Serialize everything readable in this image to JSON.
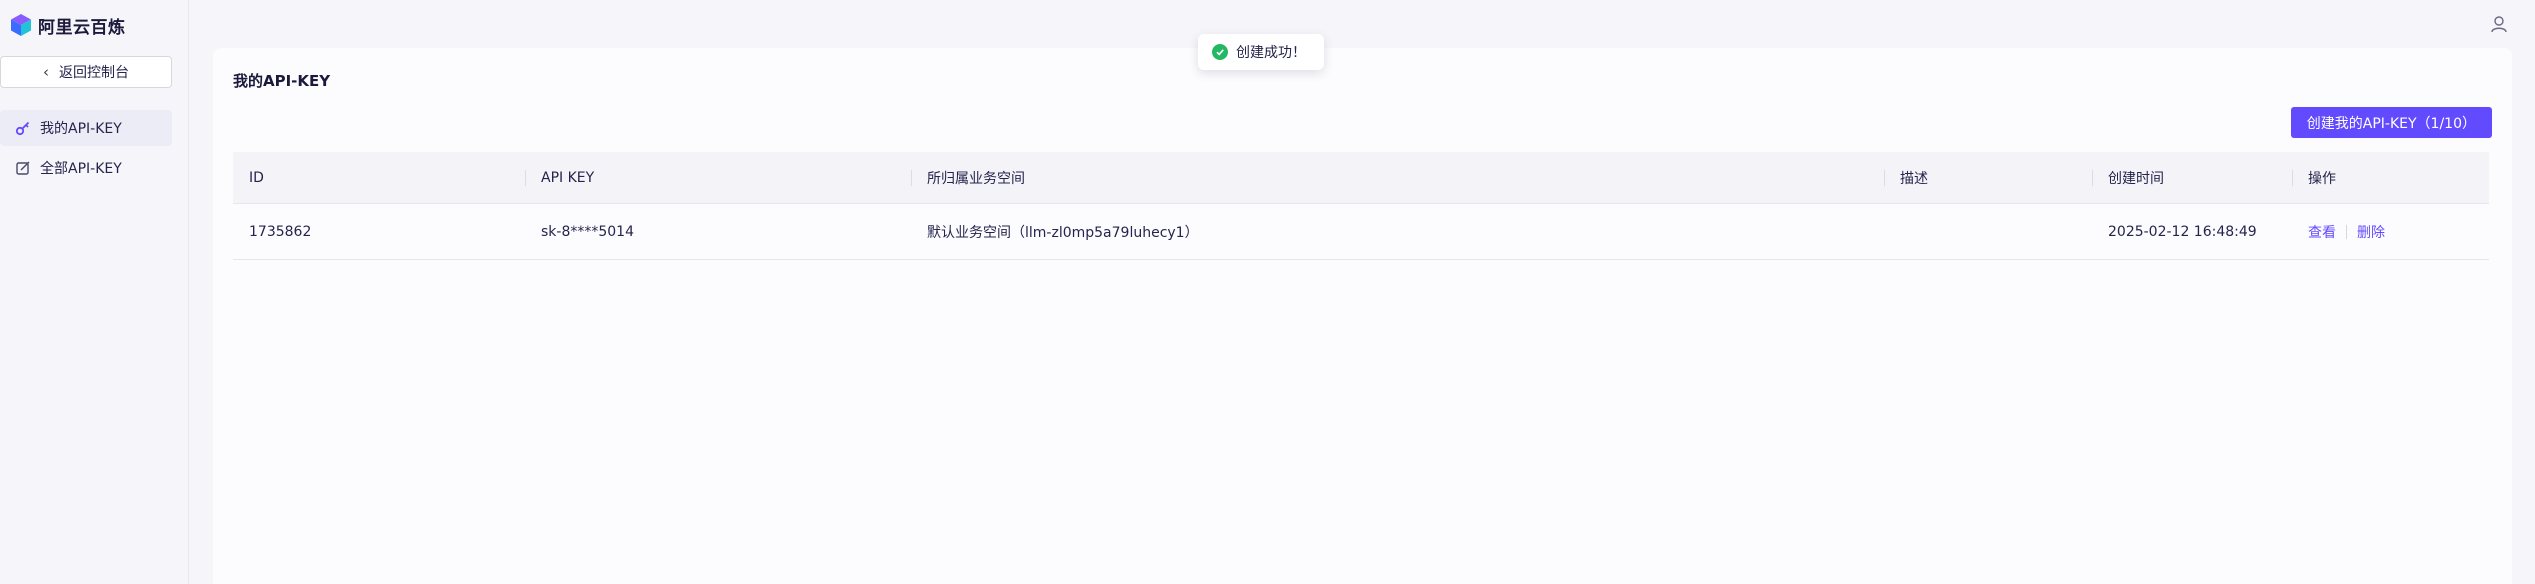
{
  "brand": {
    "name": "阿里云百炼"
  },
  "sidebar": {
    "back_label": "返回控制台",
    "items": [
      {
        "label": "我的API-KEY",
        "icon": "key-icon",
        "active": true
      },
      {
        "label": "全部API-KEY",
        "icon": "edit-box-icon",
        "active": false
      }
    ]
  },
  "toast": {
    "message": "创建成功！",
    "icon": "check-circle-icon",
    "color": "#25b864"
  },
  "main": {
    "title": "我的API-KEY",
    "create_button": "创建我的API-KEY（1/10）",
    "accent": "#624aff",
    "table": {
      "columns": [
        "ID",
        "API KEY",
        "所归属业务空间",
        "描述",
        "创建时间",
        "操作"
      ],
      "rows": [
        {
          "id": "1735862",
          "api_key": "sk-8****5014",
          "workspace": "默认业务空间（llm-zl0mp5a79luhecy1）",
          "description": "",
          "created": "2025-02-12 16:48:49",
          "actions": {
            "view": "查看",
            "delete": "删除"
          }
        }
      ]
    }
  }
}
